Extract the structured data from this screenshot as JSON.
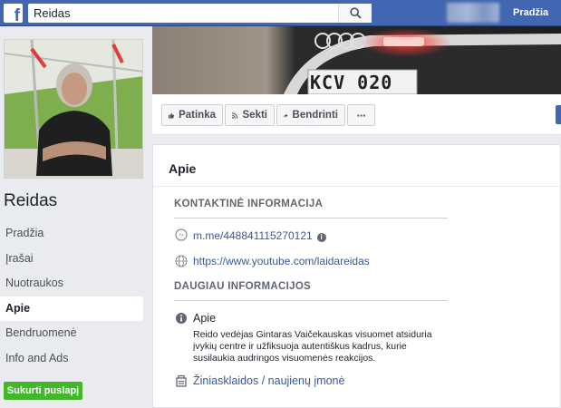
{
  "topbar": {
    "logo": "f",
    "search_value": "Reidas",
    "home_label": "Pradžia"
  },
  "page": {
    "name": "Reidas"
  },
  "nav": {
    "items": [
      {
        "label": "Pradžia"
      },
      {
        "label": "Įrašai"
      },
      {
        "label": "Nuotraukos"
      },
      {
        "label": "Apie"
      },
      {
        "label": "Bendruomenė"
      },
      {
        "label": "Info and Ads"
      }
    ],
    "active": "Apie",
    "create_page_label": "Sukurti puslapį"
  },
  "cover": {
    "plate_text": "KCV 020"
  },
  "actions": {
    "like_label": "Patinka",
    "follow_label": "Sekti",
    "share_label": "Bendrinti",
    "more_label": "···"
  },
  "about": {
    "title": "Apie",
    "contact_header": "KONTAKTINĖ INFORMACIJA",
    "messenger_link": "m.me/448841115270121",
    "website_link": "https://www.youtube.com/laidareidas",
    "more_header": "DAUGIAU INFORMACIJOS",
    "about_label": "Apie",
    "about_text": "Reido vedėjas Gintaras Vaičekauskas visuomet atsiduria įvykių centre ir užfiksuoja autentiškus kadrus, kurie susilaukia audringos visuomenės reakcijos.",
    "category": "Žiniasklaidos / naujienų įmonė"
  },
  "colors": {
    "brand_blue": "#4267b2",
    "link": "#385898",
    "green": "#42b72a",
    "bg": "#e9ebee"
  },
  "icons": [
    "facebook-logo-icon",
    "search-icon",
    "like-icon",
    "rss-icon",
    "share-icon",
    "messenger-icon",
    "globe-icon",
    "info-icon",
    "category-icon"
  ]
}
